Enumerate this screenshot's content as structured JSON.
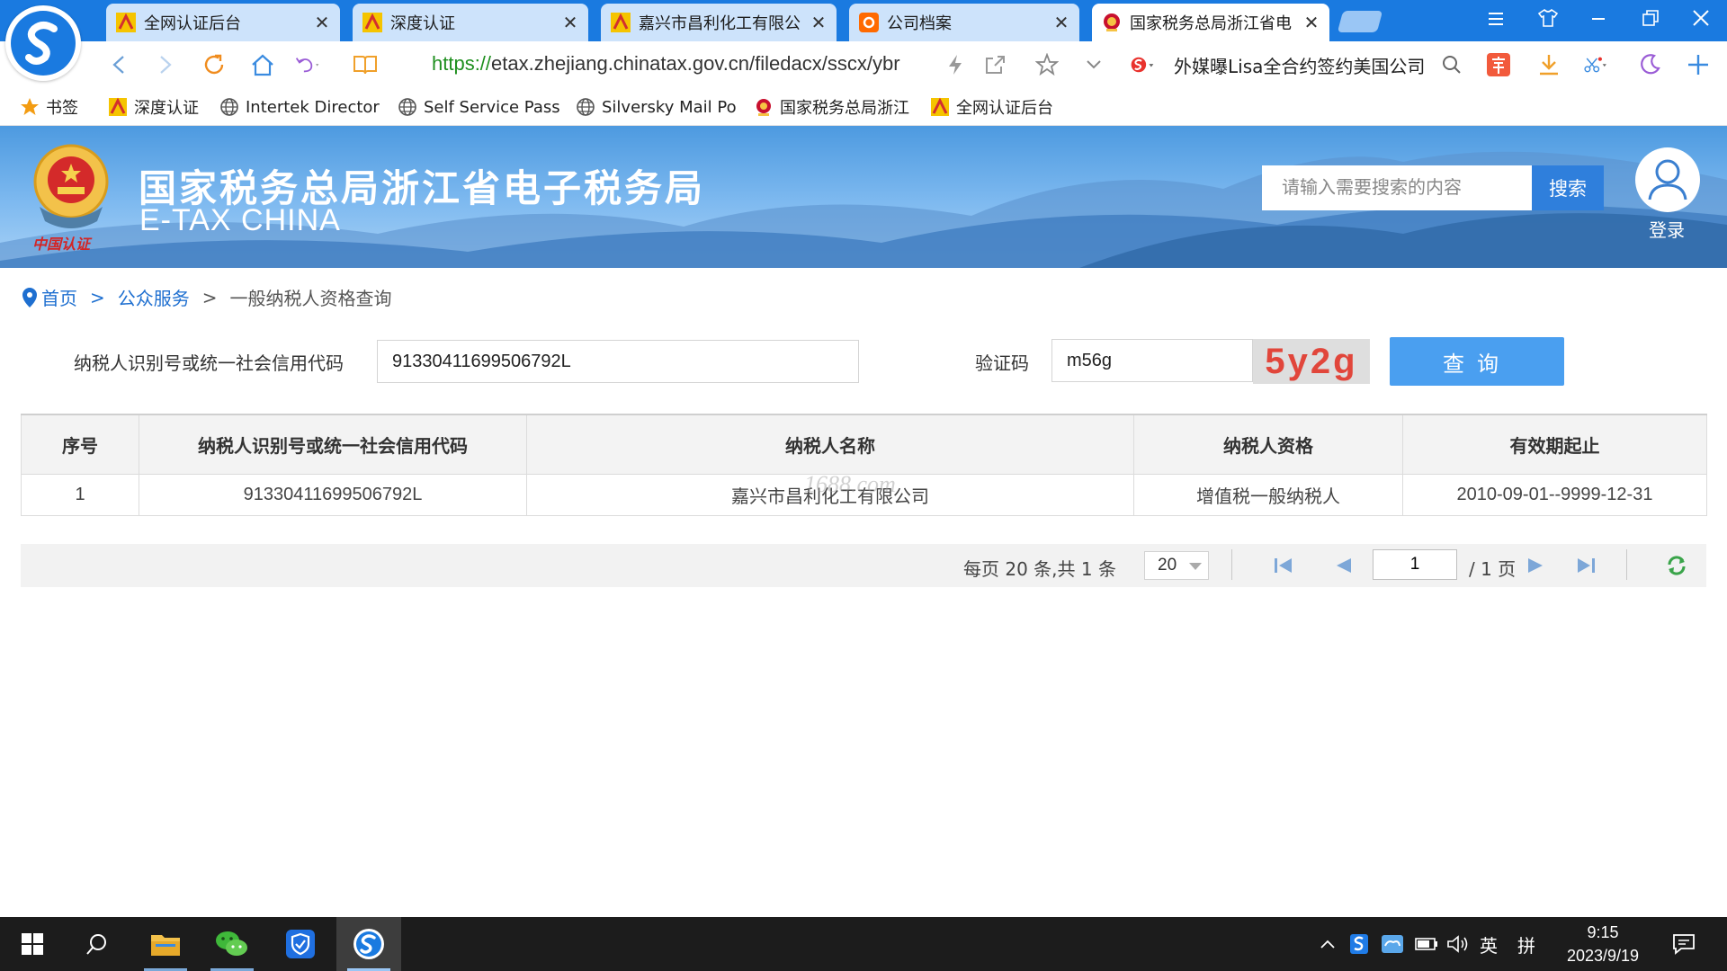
{
  "browser": {
    "tabs": [
      {
        "title": "全网认证后台",
        "icon": "certification-favicon",
        "active": false
      },
      {
        "title": "深度认证",
        "icon": "certification-favicon",
        "active": false
      },
      {
        "title": "嘉兴市昌利化工有限公",
        "icon": "certification-favicon",
        "active": false
      },
      {
        "title": "公司档案",
        "icon": "alibaba-1688-favicon",
        "active": false
      },
      {
        "title": "国家税务总局浙江省电",
        "icon": "tax-emblem-favicon",
        "active": true
      }
    ],
    "close_glyph": "✕",
    "address": {
      "scheme": "https://",
      "rest": "etax.zhejiang.chinatax.gov.cn/filedacx/sscx/ybr"
    },
    "search_engine_text": "外媒曝Lisa全合约签约美国公司",
    "bookmarks": [
      {
        "label": "书签",
        "icon": "star-icon"
      },
      {
        "label": "深度认证",
        "icon": "certification-favicon"
      },
      {
        "label": "Intertek Director",
        "icon": "globe-icon"
      },
      {
        "label": "Self Service Pass",
        "icon": "globe-icon"
      },
      {
        "label": "Silversky Mail Po",
        "icon": "globe-icon"
      },
      {
        "label": "国家税务总局浙江",
        "icon": "tax-emblem-favicon"
      },
      {
        "label": "全网认证后台",
        "icon": "certification-favicon"
      }
    ],
    "accent_color": "#1a7ae0"
  },
  "site": {
    "title": "国家税务总局浙江省电子税务局",
    "subtitle": "E-TAX CHINA",
    "search_placeholder": "请输入需要搜索的内容",
    "search_button": "搜索",
    "login_label": "登录",
    "emblem_text": "中国认证"
  },
  "breadcrumb": {
    "home": "首页",
    "section": "公众服务",
    "current": "一般纳税人资格查询",
    "separator": ">"
  },
  "form": {
    "taxid_label": "纳税人识别号或统一社会信用代码",
    "taxid_value": "91330411699506792L",
    "captcha_label": "验证码",
    "captcha_value": "m56g",
    "captcha_image_text": "5y2g",
    "query_button": "查询"
  },
  "table": {
    "headers": [
      "序号",
      "纳税人识别号或统一社会信用代码",
      "纳税人名称",
      "纳税人资格",
      "有效期起止"
    ],
    "rows": [
      [
        "1",
        "91330411699506792L",
        "嘉兴市昌利化工有限公司",
        "增值税一般纳税人",
        "2010-09-01--9999-12-31"
      ]
    ],
    "watermark": "1688.com"
  },
  "pagination": {
    "info": "每页 20 条,共 1 条",
    "page_size": "20",
    "current_page": "1",
    "total_pages_text": "/ 1 页"
  },
  "taskbar": {
    "apps": [
      "windows-start-icon",
      "search-icon",
      "file-explorer-icon",
      "wechat-icon",
      "shield-app-icon",
      "sogou-browser-icon"
    ],
    "ime_lang": "英",
    "ime_mode": "拼",
    "time": "9:15",
    "date": "2023/9/19"
  }
}
